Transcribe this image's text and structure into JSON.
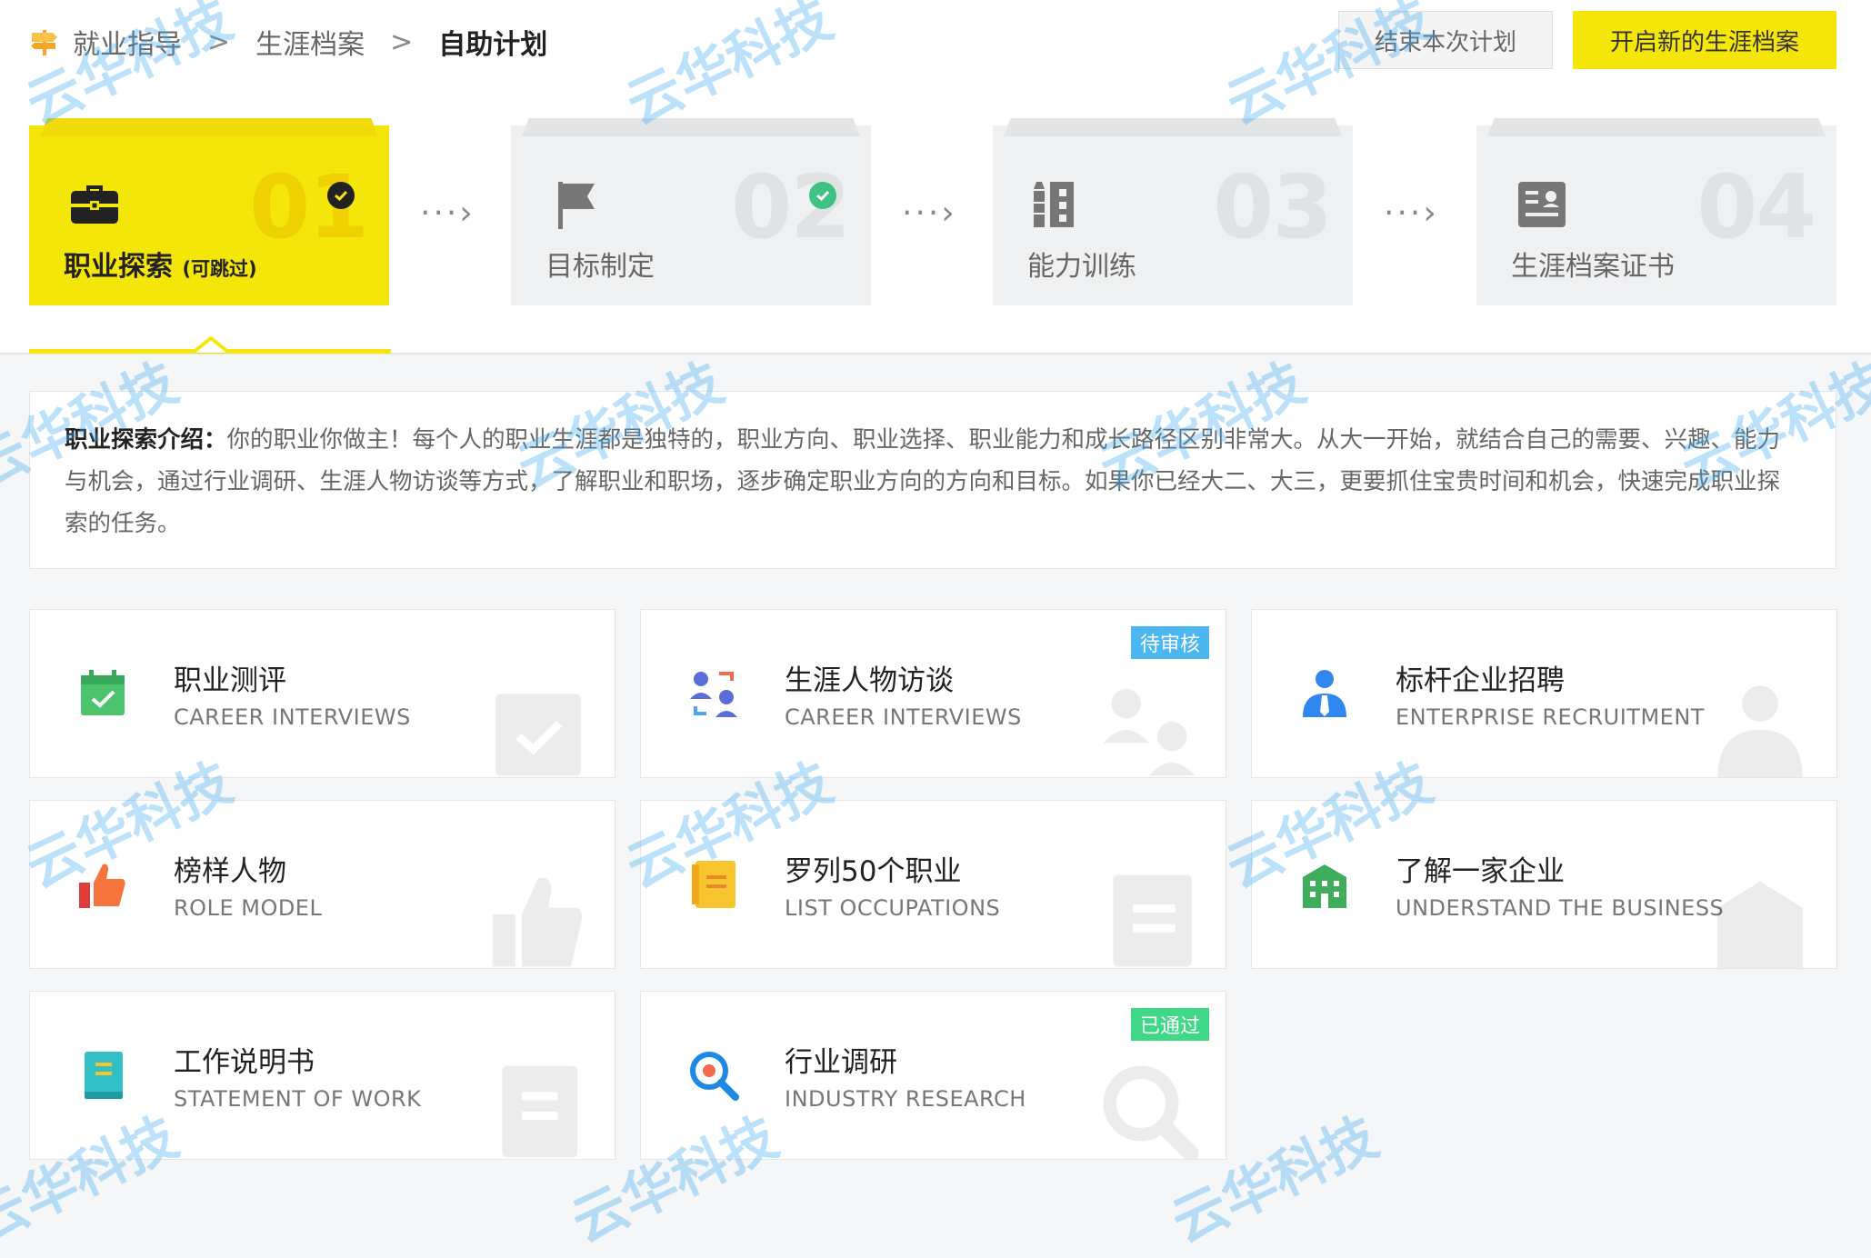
{
  "breadcrumb": {
    "items": [
      "就业指导",
      "生涯档案",
      "自助计划"
    ],
    "separator": ">"
  },
  "actions": {
    "end_plan": "结束本次计划",
    "new_archive": "开启新的生涯档案"
  },
  "steps": [
    {
      "num": "01",
      "label": "职业探索",
      "note": "(可跳过)",
      "icon": "briefcase-icon",
      "completed": true,
      "active": true
    },
    {
      "num": "02",
      "label": "目标制定",
      "icon": "flag-icon",
      "completed": true,
      "active": false
    },
    {
      "num": "03",
      "label": "能力训练",
      "icon": "training-icon",
      "completed": false,
      "active": false
    },
    {
      "num": "04",
      "label": "生涯档案证书",
      "icon": "certificate-icon",
      "completed": false,
      "active": false
    }
  ],
  "step_arrow": "···›",
  "intro": {
    "title": "职业探索介绍：",
    "text": "你的职业你做主！每个人的职业生涯都是独特的，职业方向、职业选择、职业能力和成长路径区别非常大。从大一开始，就结合自己的需要、兴趣、能力与机会，通过行业调研、生涯人物访谈等方式，了解职业和职场，逐步确定职业方向的方向和目标。如果你已经大二、大三，更要抓住宝贵时间和机会，快速完成职业探索的任务。"
  },
  "cards": [
    {
      "title": "职业测评",
      "subtitle": "CAREER INTERVIEWS",
      "icon": "calendar-check-icon",
      "badge": ""
    },
    {
      "title": "生涯人物访谈",
      "subtitle": "CAREER INTERVIEWS",
      "icon": "people-icon",
      "badge": "待审核"
    },
    {
      "title": "标杆企业招聘",
      "subtitle": "ENTERPRISE RECRUITMENT",
      "icon": "person-tie-icon",
      "badge": ""
    },
    {
      "title": "榜样人物",
      "subtitle": "ROLE MODEL",
      "icon": "thumbs-up-icon",
      "badge": ""
    },
    {
      "title": "罗列50个职业",
      "subtitle": "LIST OCCUPATIONS",
      "icon": "notebook-icon",
      "badge": ""
    },
    {
      "title": "了解一家企业",
      "subtitle": "UNDERSTAND THE BUSINESS",
      "icon": "building-icon",
      "badge": ""
    },
    {
      "title": "工作说明书",
      "subtitle": "STATEMENT OF WORK",
      "icon": "book-icon",
      "badge": ""
    },
    {
      "title": "行业调研",
      "subtitle": "INDUSTRY RESEARCH",
      "icon": "search-icon",
      "badge": "已通过"
    }
  ],
  "colors": {
    "accent": "#f5e60a",
    "pending": "#4bb6f0",
    "passed": "#3fd886",
    "check_green": "#3fc380"
  },
  "watermark": "云华科技"
}
